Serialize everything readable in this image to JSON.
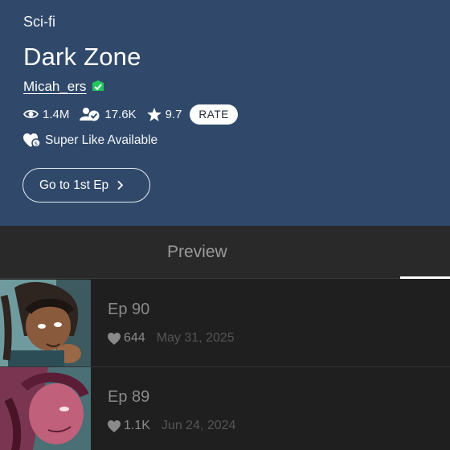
{
  "series": {
    "genre": "Sci-fi",
    "title": "Dark Zone",
    "author": "Micah_ers",
    "stats": {
      "views": "1.4M",
      "subscribers": "17.6K",
      "rating": "9.7"
    },
    "rate_label": "RATE",
    "super_like_text": "Super Like Available",
    "go_button_label": "Go to 1st Ep"
  },
  "tabs": {
    "preview_label": "Preview"
  },
  "episodes": [
    {
      "title": "Ep 90",
      "likes": "644",
      "date": "May 31, 2025"
    },
    {
      "title": "Ep 89",
      "likes": "1.1K",
      "date": "Jun 24, 2024"
    }
  ],
  "colors": {
    "header_bg": "#30496a",
    "verified_badge": "#22c55e",
    "page_bg": "#1f1f1f"
  },
  "icons": [
    "eye-icon",
    "subscribers-icon",
    "star-icon",
    "super-like-heart-icon",
    "chevron-right-icon",
    "verified-icon",
    "heart-icon"
  ]
}
